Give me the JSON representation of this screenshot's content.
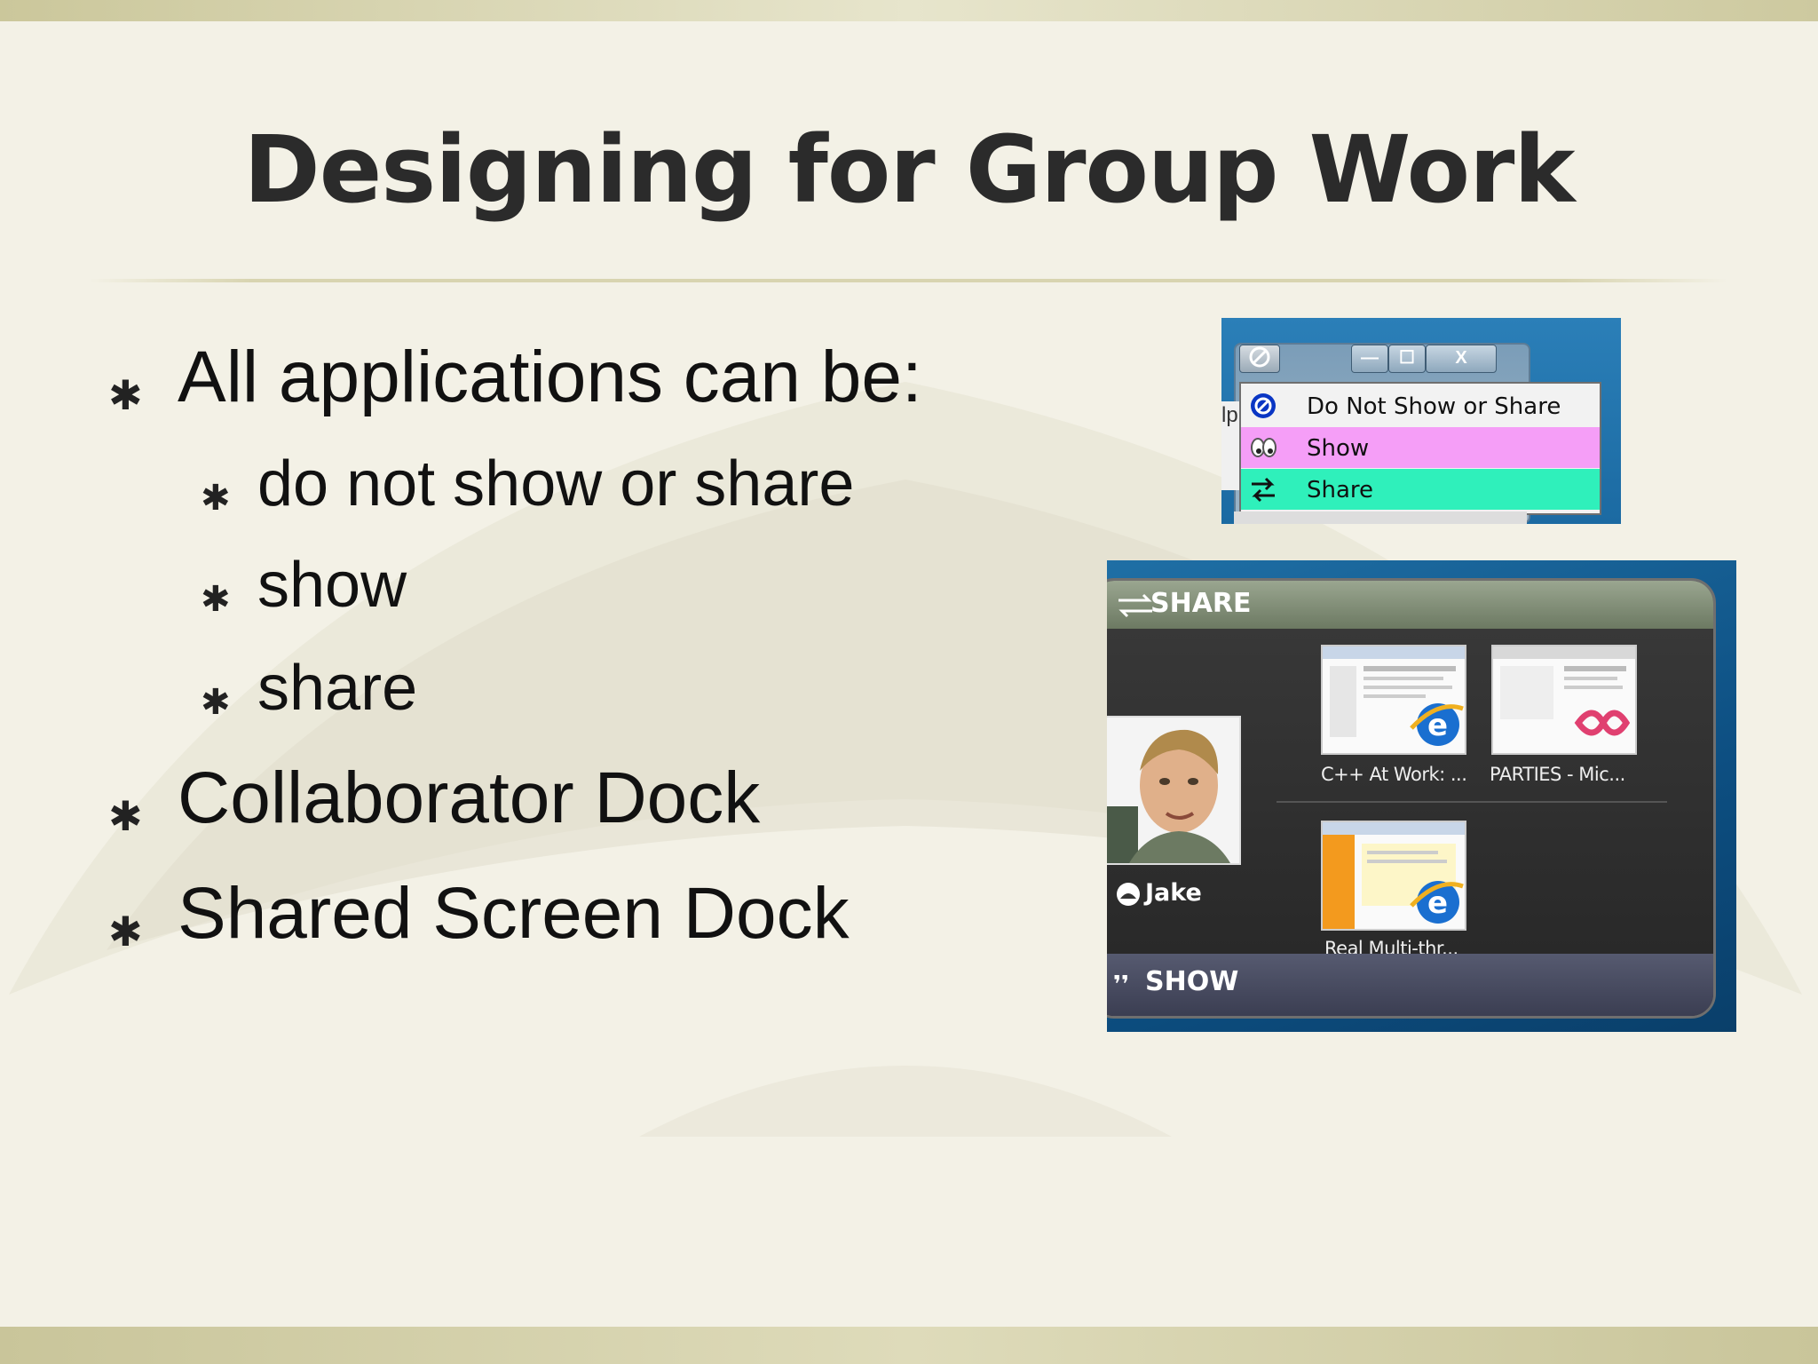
{
  "slide": {
    "title": "Designing for Group Work",
    "bullets": [
      {
        "text": "All applications can be:",
        "level": 1
      },
      {
        "text": "do not show or share",
        "level": 2
      },
      {
        "text": "show",
        "level": 2
      },
      {
        "text": "share",
        "level": 2
      },
      {
        "text": "Collaborator Dock",
        "level": 1
      },
      {
        "text": "Shared Screen Dock",
        "level": 1
      }
    ],
    "bullet_glyph_l1": "✱",
    "bullet_glyph_l2": "✱"
  },
  "context_menu_screenshot": {
    "title_buttons": {
      "minimize": "—",
      "maximize": "☐",
      "close": "X"
    },
    "partial_window_text": "lp",
    "items": [
      {
        "label": "Do Not Show or Share",
        "icon": "prohibited-icon",
        "color": "#f2f2f2"
      },
      {
        "label": "Show",
        "icon": "eyes-icon",
        "color": "#f59ef7"
      },
      {
        "label": "Share",
        "icon": "swap-arrows-icon",
        "color": "#2ff0bb"
      }
    ]
  },
  "dock_screenshot": {
    "share_label": "SHARE",
    "show_label": "SHOW",
    "show_icon": "❜❜",
    "collaborator_name": "Jake",
    "thumbnails": [
      {
        "caption": "C++ At Work: ...",
        "app_icon": "ie-icon"
      },
      {
        "caption": "PARTIES - Mic...",
        "app_icon": "vs-icon"
      },
      {
        "caption": "Real Multi-thr...",
        "app_icon": "ie-icon"
      }
    ]
  },
  "colors": {
    "background": "#f3f1e6",
    "title": "#2b2b2b",
    "accent_bar": "#cbc79b",
    "show_highlight": "#f59ef7",
    "share_highlight": "#2ff0bb"
  }
}
